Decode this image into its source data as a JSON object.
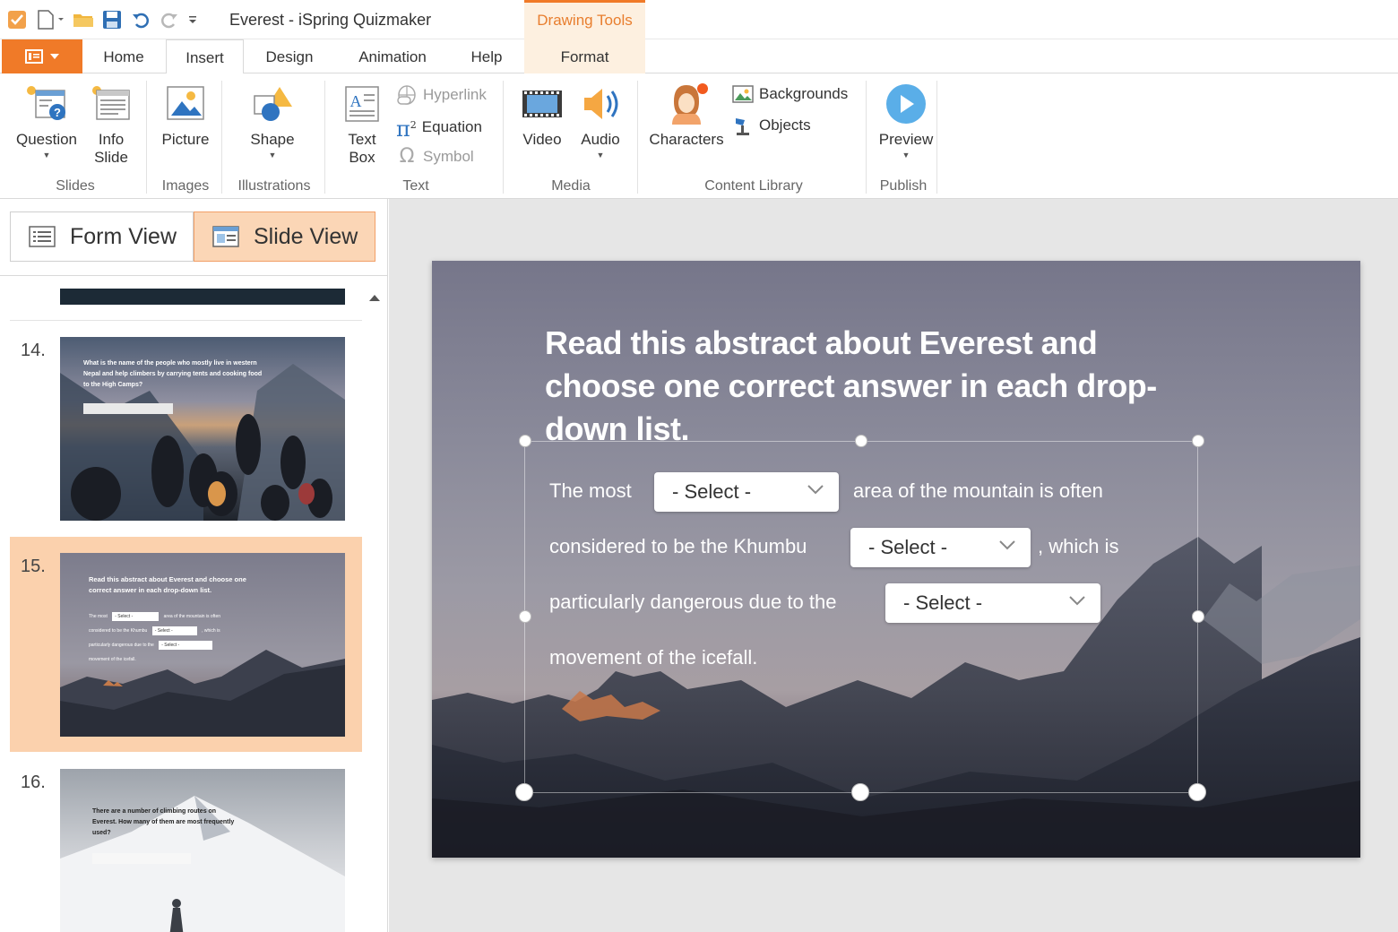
{
  "window": {
    "title": "Everest - iSpring Quizmaker"
  },
  "context_tab": {
    "group_label": "Drawing Tools",
    "tab_label": "Format"
  },
  "colors": {
    "accent": "#f07a28",
    "selected_thumb": "#fbd1ad",
    "context_bg": "#fdf0e0"
  },
  "tabs": [
    "Home",
    "Insert",
    "Design",
    "Animation",
    "Help"
  ],
  "active_tab": "Insert",
  "ribbon": {
    "slides": {
      "group": "Slides",
      "question": "Question",
      "info_slide_1": "Info",
      "info_slide_2": "Slide"
    },
    "images": {
      "group": "Images",
      "picture": "Picture"
    },
    "illustrations": {
      "group": "Illustrations",
      "shape": "Shape"
    },
    "text": {
      "group": "Text",
      "text_box_1": "Text",
      "text_box_2": "Box",
      "hyperlink": "Hyperlink",
      "equation": "Equation",
      "symbol": "Symbol"
    },
    "media": {
      "group": "Media",
      "video": "Video",
      "audio": "Audio"
    },
    "content_library": {
      "group": "Content Library",
      "characters": "Characters",
      "backgrounds": "Backgrounds",
      "objects": "Objects"
    },
    "publish": {
      "group": "Publish",
      "preview": "Preview"
    }
  },
  "views": {
    "form_view": "Form View",
    "slide_view": "Slide View",
    "active": "Slide View"
  },
  "slides_panel": {
    "items": [
      {
        "number": "14.",
        "text": "What is the name of the people who mostly live in western Nepal and help climbers by carrying tents and cooking food to the High Camps?"
      },
      {
        "number": "15.",
        "text": "Read this abstract about Everest and choose one correct answer in each drop-down list.",
        "mini_line_1": "The most",
        "mini_line_1b": "area of the mountain is often",
        "mini_line_2": "considered to be the Khumbu",
        "mini_line_2b": ", which is",
        "mini_line_3": "particularly dangerous due to the",
        "mini_line_4": "movement of the icefall.",
        "mini_select": "- Select -"
      },
      {
        "number": "16.",
        "text": "There are a number of climbing routes on Everest. How many of them are most frequently used?"
      }
    ],
    "selected": "15."
  },
  "slide": {
    "question": "Read this abstract about Everest and choose one correct answer in each drop-down list.",
    "line1_a": "The most",
    "line1_b": "area of the mountain is often",
    "line2_a": "considered to be the Khumbu",
    "line2_b": ", which is",
    "line3_a": "particularly dangerous due to the",
    "line4": "movement of the icefall.",
    "dropdowns": [
      "- Select -",
      "- Select -",
      "- Select -"
    ]
  }
}
